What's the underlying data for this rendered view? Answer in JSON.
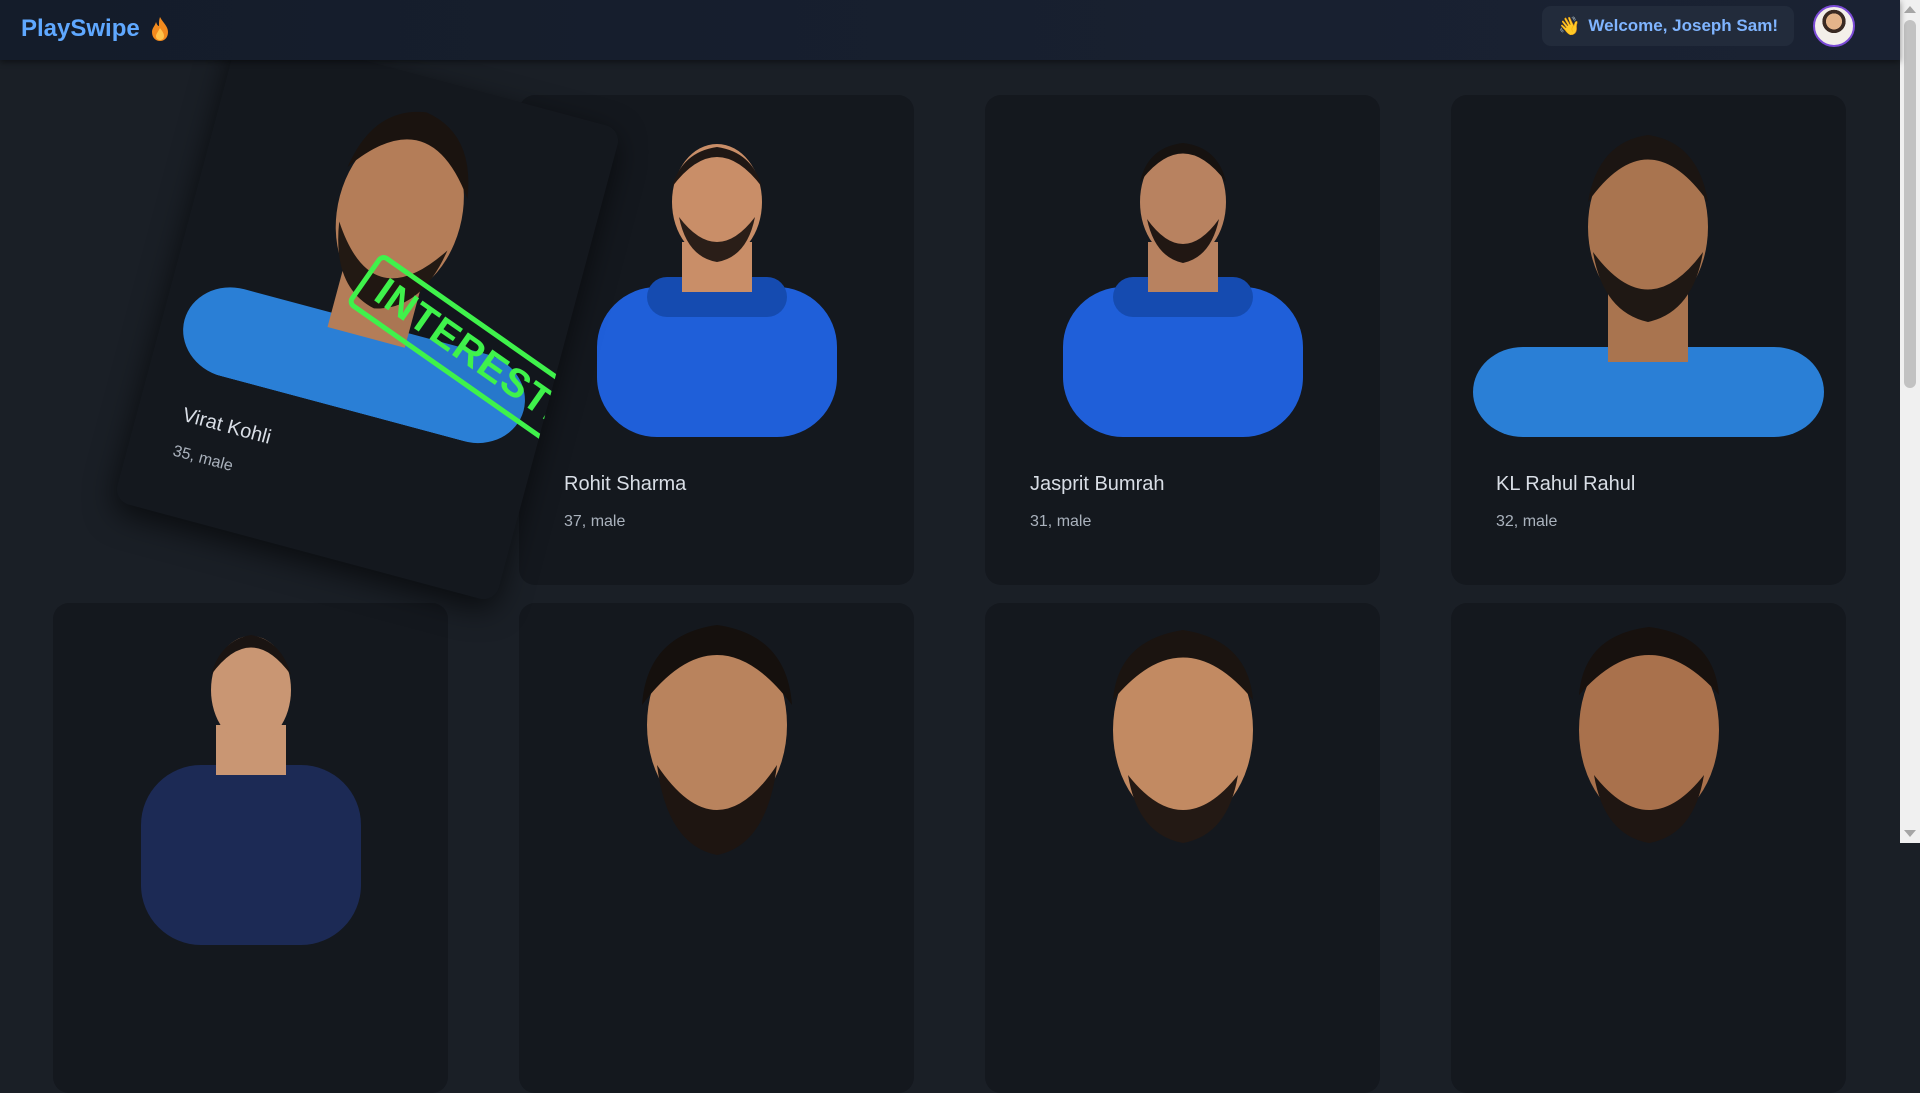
{
  "header": {
    "brand": "PlaySwipe",
    "brand_icon": "flame-icon",
    "welcome_icon": "waving-hand-icon",
    "welcome_text": "Welcome, Joseph Sam!",
    "avatar_icon": "user-avatar"
  },
  "swiped_card": {
    "name": "Virat Kohli",
    "meta": "35, male",
    "stamp": "INTERESTED",
    "jersey": "#2a7fd6"
  },
  "cards": [
    {
      "name": "Rohit Sharma",
      "meta": "37, male",
      "jersey": "#1f5fd9"
    },
    {
      "name": "Jasprit Bumrah",
      "meta": "31, male",
      "jersey": "#1f5fd9"
    },
    {
      "name": "KL Rahul Rahul",
      "meta": "32, male",
      "jersey": "#2a7fd6"
    },
    {
      "name": "",
      "meta": "",
      "jersey": "#1c2a55"
    },
    {
      "name": "",
      "meta": "",
      "jersey": "#2a7fd6"
    },
    {
      "name": "",
      "meta": "",
      "jersey": "#2a7fd6"
    },
    {
      "name": "",
      "meta": "",
      "jersey": "#2a7fd6"
    }
  ],
  "colors": {
    "brand": "#5fa8ff",
    "background": "#1a1f26",
    "card": "#14181e",
    "stamp": "#3ff24b",
    "avatar_border": "#7b4bd6"
  }
}
